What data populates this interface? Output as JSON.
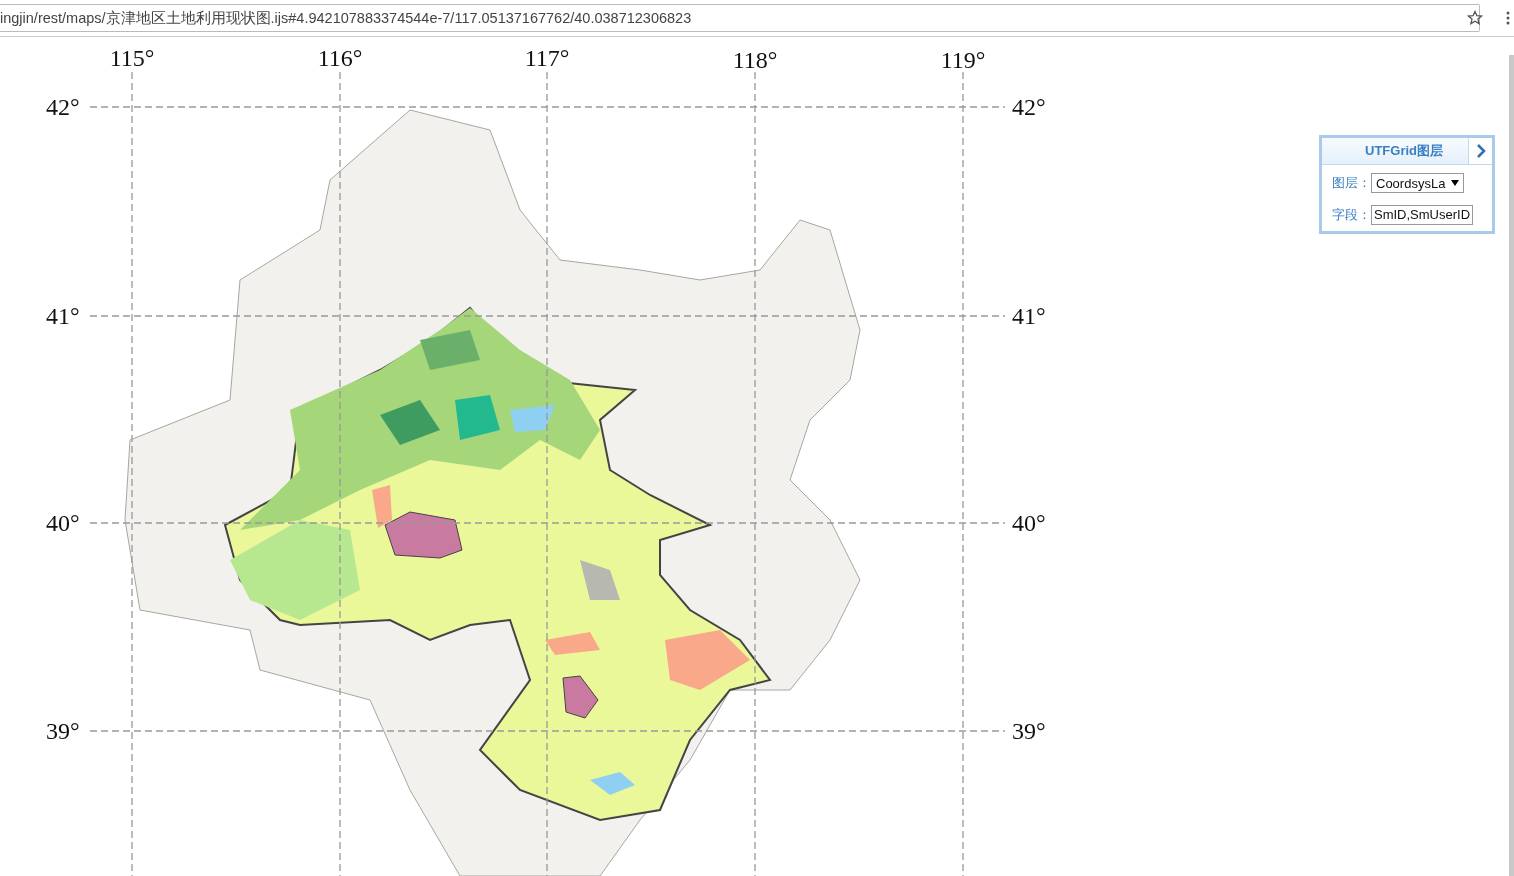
{
  "browser": {
    "url": "ingjin/rest/maps/京津地区土地利用现状图.ijs#4.942107883374544e-7/117.05137167762/40.038712306823"
  },
  "graticule": {
    "longitudes": [
      {
        "label": "115°"
      },
      {
        "label": "116°"
      },
      {
        "label": "117°"
      },
      {
        "label": "118°"
      },
      {
        "label": "119°"
      }
    ],
    "latitudes": [
      {
        "left": "42°",
        "right": "42°"
      },
      {
        "left": "41°",
        "right": "41°"
      },
      {
        "left": "40°",
        "right": "40°"
      },
      {
        "left": "39°",
        "right": "39°"
      }
    ]
  },
  "utfgrid_panel": {
    "title": "UTFGrid图层",
    "fields": [
      {
        "kind": "select",
        "label": "图层：",
        "value": "CoordsysLa"
      },
      {
        "kind": "text",
        "label": "字段：",
        "value": "SmID,SmUserID"
      }
    ]
  }
}
